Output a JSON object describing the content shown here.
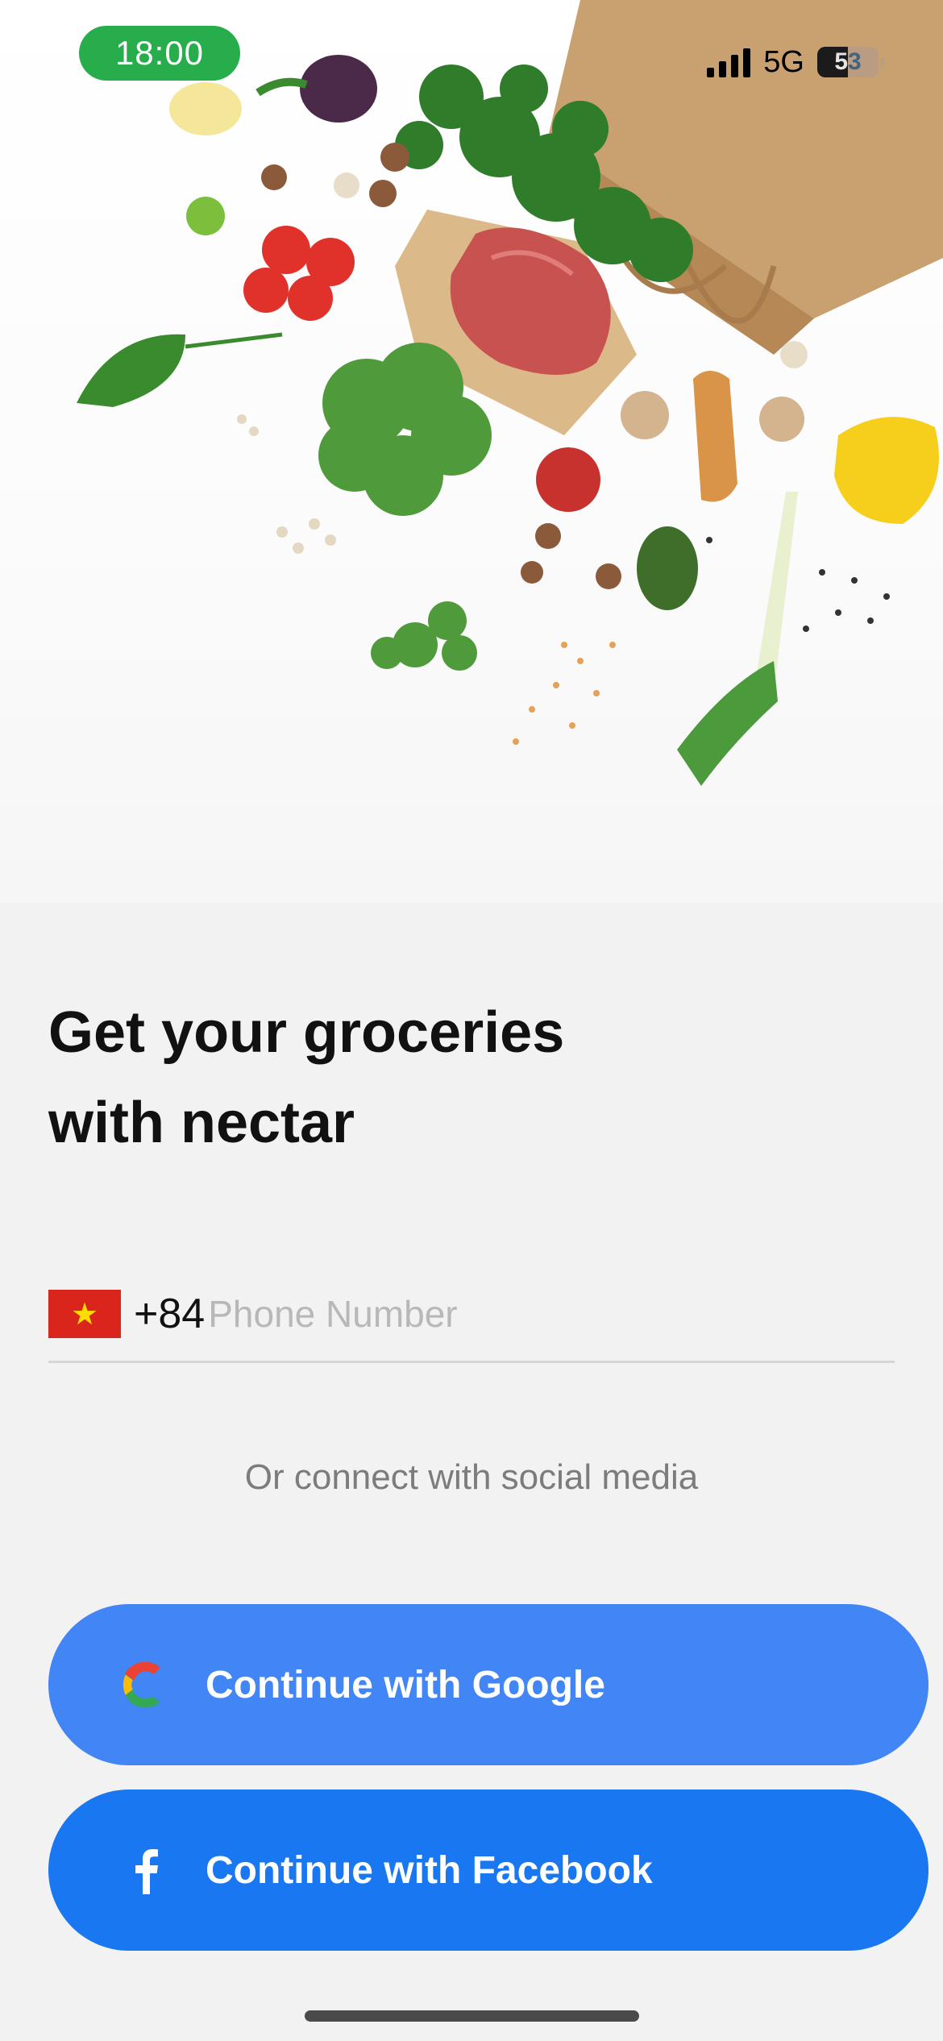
{
  "status_bar": {
    "time": "18:00",
    "network": "5G",
    "battery": "53"
  },
  "headline": {
    "line1": "Get your groceries",
    "line2": "with nectar"
  },
  "phone": {
    "flag_symbol": "★",
    "country_code": "+84",
    "placeholder": "Phone Number",
    "value": ""
  },
  "social_text": "Or connect with social media",
  "buttons": {
    "google": "Continue with Google",
    "facebook": "Continue with Facebook"
  },
  "colors": {
    "status_time_bg": "#27ad4b",
    "google_button": "#4285f4",
    "facebook_button": "#1977f2",
    "flag_red": "#da251d"
  }
}
